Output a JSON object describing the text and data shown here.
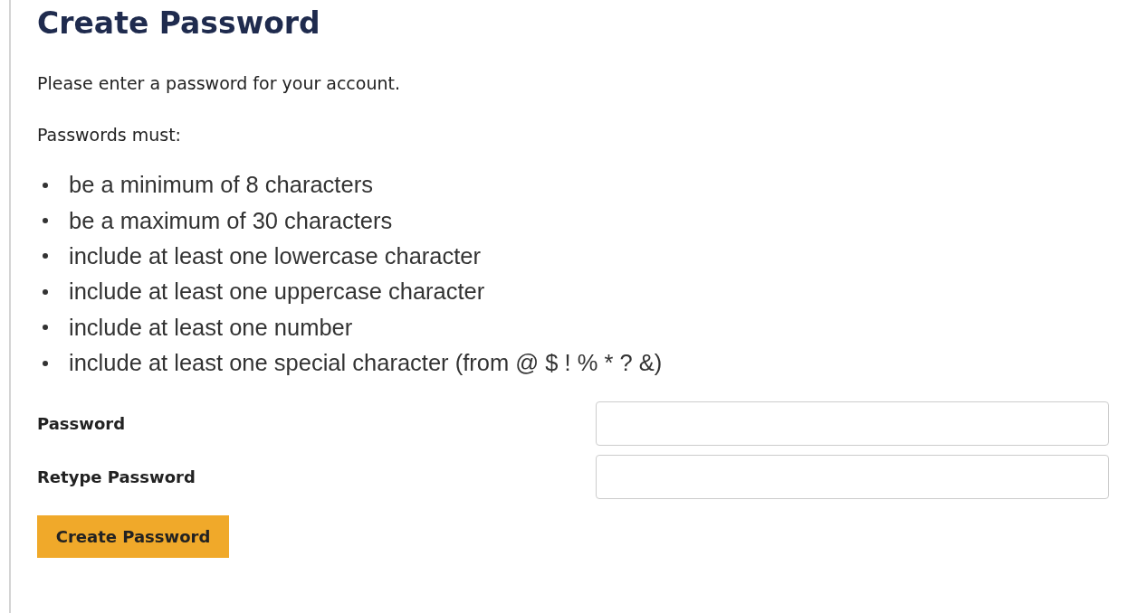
{
  "title": "Create Password",
  "intro": "Please enter a password for your account.",
  "rules_heading": "Passwords must:",
  "rules": [
    "be a minimum of 8 characters",
    "be a maximum of 30 characters",
    "include at least one lowercase character",
    "include at least one uppercase character",
    "include at least one number",
    "include at least one special character (from @ $ ! % * ? &)"
  ],
  "fields": [
    {
      "label": "Password"
    },
    {
      "label": "Retype Password"
    }
  ],
  "submit_button": "Create Password"
}
